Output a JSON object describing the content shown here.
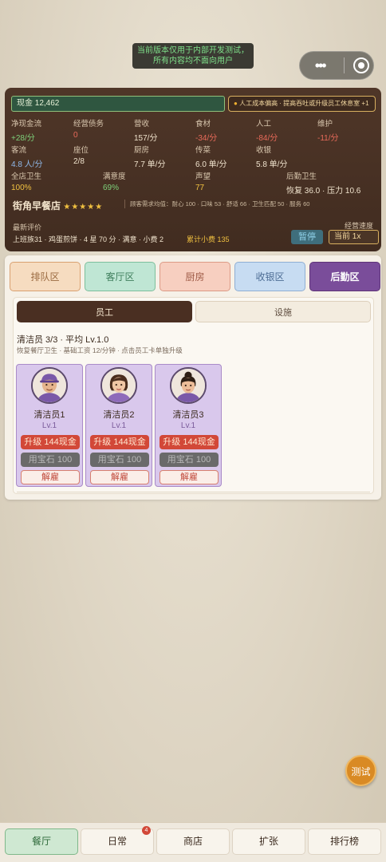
{
  "notice": {
    "line1": "当前版本仅用于内部开发测试，",
    "line2": "所有内容均不面向用户"
  },
  "capsule": {
    "more": "•••"
  },
  "stats": {
    "cash": "现金 12,462",
    "alert": "人工成本偏高 · 提高吞吐或升级员工休息室 +1",
    "row1": [
      {
        "label": "净现金流",
        "value": "+28/分",
        "tone": "green"
      },
      {
        "label": "经营债务",
        "value": "0",
        "tone": "red"
      },
      {
        "label": "营收",
        "value": "157/分",
        "tone": ""
      },
      {
        "label": "食材",
        "value": "-34/分",
        "tone": "red"
      },
      {
        "label": "人工",
        "value": "-84/分",
        "tone": "red"
      },
      {
        "label": "维护",
        "value": "-11/分",
        "tone": "red"
      }
    ],
    "row2": [
      {
        "label": "客流",
        "value": "4.8 人/分",
        "tone": "blue"
      },
      {
        "label": "座位",
        "value": "2/8",
        "tone": ""
      },
      {
        "label": "厨房",
        "value": "7.7 单/分",
        "tone": ""
      },
      {
        "label": "传菜",
        "value": "6.0 单/分",
        "tone": ""
      },
      {
        "label": "收银",
        "value": "5.8 单/分",
        "tone": ""
      }
    ],
    "row3": [
      {
        "label": "全店卫生",
        "value": "100%",
        "tone": "yellow"
      },
      {
        "label": "满意度",
        "value": "69%",
        "tone": "green"
      },
      {
        "label": "声望",
        "value": "77",
        "tone": "yellow"
      },
      {
        "label": "后勤卫生",
        "value": "恢复 36.0 · 压力 10.6",
        "tone": ""
      }
    ],
    "restaurant_name": "街角早餐店",
    "stars": "★★★★★",
    "demand": "顾客需求均值：耐心 100 · 口味 53 · 舒适 66 · 卫生匹配 50 · 服务 60",
    "review_label": "最新评价",
    "review": "上班族31 · 鸡蛋煎饼 · 4 星 70 分 · 满意 · 小费 2",
    "tips": "累计小费 135",
    "speed_label": "经营速度",
    "pause": "暂停",
    "speed": "当前 1x"
  },
  "areas": [
    "排队区",
    "客厅区",
    "厨房",
    "收银区",
    "后勤区"
  ],
  "tabs": {
    "staff": "员工",
    "facility": "设施"
  },
  "role": {
    "title": "清洁员 3/3 · 平均 Lv.1.0",
    "desc": "恢复餐厅卫生 · 基础工资 12/分钟 · 点击员工卡单独升级"
  },
  "staff": [
    {
      "name": "清洁员1",
      "level": "Lv.1",
      "upgrade": "升级 144现金",
      "gem": "用宝石 100",
      "fire": "解雇"
    },
    {
      "name": "清洁员2",
      "level": "Lv.1",
      "upgrade": "升级 144现金",
      "gem": "用宝石 100",
      "fire": "解雇"
    },
    {
      "name": "清洁员3",
      "level": "Lv.1",
      "upgrade": "升级 144现金",
      "gem": "用宝石 100",
      "fire": "解雇"
    }
  ],
  "test_button": "测试",
  "nav": [
    {
      "label": "餐厅",
      "active": true
    },
    {
      "label": "日常",
      "badge": "4"
    },
    {
      "label": "商店"
    },
    {
      "label": "扩张"
    },
    {
      "label": "排行榜"
    }
  ],
  "colors": {
    "panel": "#4f3628",
    "accent_purple": "#7a4d9a",
    "upgrade_red": "#d24838"
  }
}
